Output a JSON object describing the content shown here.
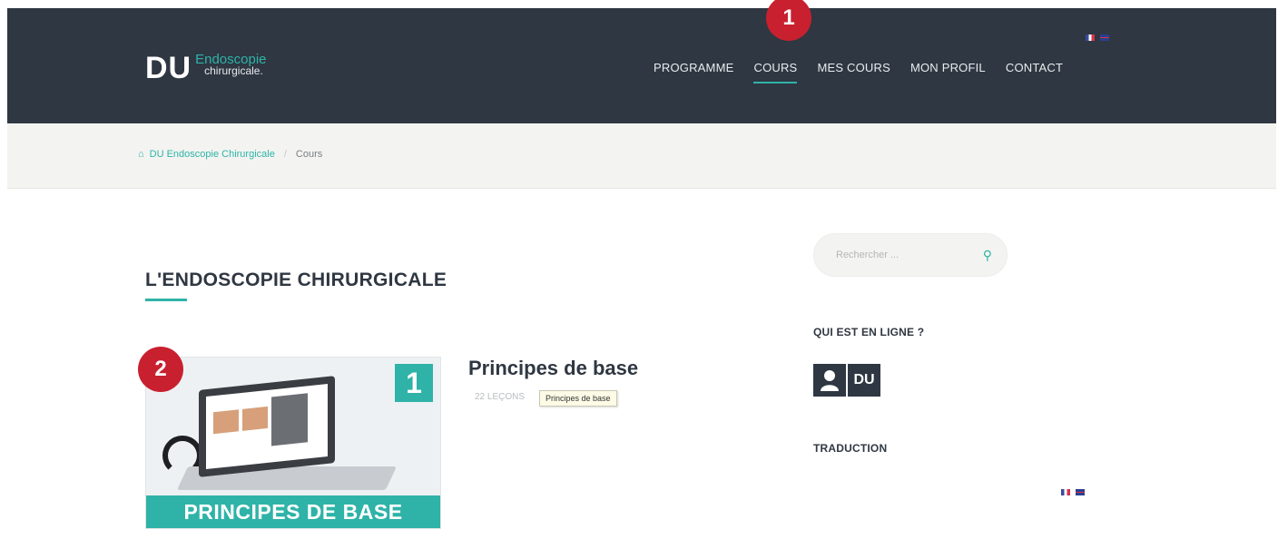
{
  "header": {
    "logo": {
      "main": "DU",
      "line1": "Endoscopie",
      "line2": "chirurgicale."
    },
    "nav": [
      {
        "label": "PROGRAMME",
        "active": false
      },
      {
        "label": "COURS",
        "active": true
      },
      {
        "label": "MES COURS",
        "active": false
      },
      {
        "label": "MON PROFIL",
        "active": false
      },
      {
        "label": "CONTACT",
        "active": false
      }
    ],
    "languages": [
      "fr-flag-icon",
      "en-flag-icon"
    ]
  },
  "callouts": {
    "first": "1",
    "second": "2"
  },
  "breadcrumb": {
    "home_icon": "home-icon",
    "home": "DU Endoscopie Chirurgicale",
    "separator": "/",
    "current": "Cours"
  },
  "main": {
    "title": "L'ENDOSCOPIE CHIRURGICALE",
    "course": {
      "number": "1",
      "band": "PRINCIPES DE BASE",
      "title": "Principes de base",
      "meta": "22 LEÇONS",
      "tooltip": "Principes de base"
    }
  },
  "sidebar": {
    "search_placeholder": "Rechercher ...",
    "who_heading": "QUI EST EN LIGNE ?",
    "who_avatar_label": "DU",
    "translation_heading": "TRADUCTION"
  },
  "colors": {
    "header_bg": "#2f3742",
    "accent": "#2fb3a8",
    "callout": "#c8202f"
  }
}
